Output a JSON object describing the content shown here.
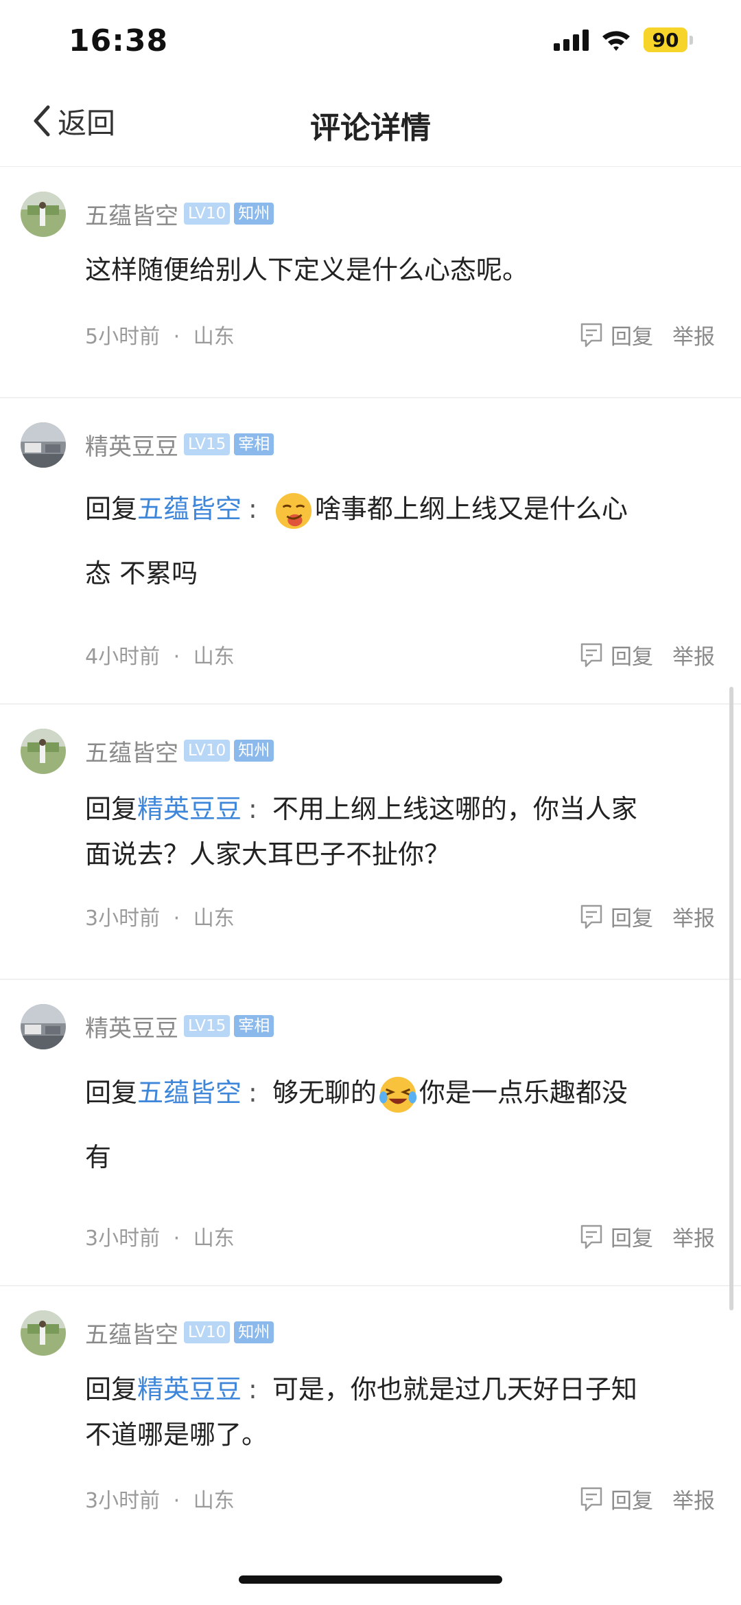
{
  "status": {
    "time": "16:38",
    "battery": "90"
  },
  "nav": {
    "back_label": "返回",
    "title": "评论详情"
  },
  "actions": {
    "reply_label": "回复",
    "report_label": "举报"
  },
  "comments": [
    {
      "user": "五蕴皆空",
      "level": "LV10",
      "title": "知州",
      "reply_prefix": "",
      "reply_target": "",
      "text": "这样随便给别人下定义是什么心态呢。",
      "time": "5小时前",
      "location": "山东"
    },
    {
      "user": "精英豆豆",
      "level": "LV15",
      "title": "宰相",
      "reply_prefix": "回复",
      "reply_target": "五蕴皆空",
      "text": "啥事都上纲上线又是什么心",
      "text_line2": "态  不累吗",
      "time": "4小时前",
      "location": "山东"
    },
    {
      "user": "五蕴皆空",
      "level": "LV10",
      "title": "知州",
      "reply_prefix": "回复",
      "reply_target": "精英豆豆",
      "text": "不用上纲上线这哪的，你当人家",
      "text_line2": "面说去？人家大耳巴子不扯你？",
      "time": "3小时前",
      "location": "山东"
    },
    {
      "user": "精英豆豆",
      "level": "LV15",
      "title": "宰相",
      "reply_prefix": "回复",
      "reply_target": "五蕴皆空",
      "text": "够无聊的",
      "text_after": "你是一点乐趣都没",
      "text_line2": "有",
      "time": "3小时前",
      "location": "山东"
    },
    {
      "user": "五蕴皆空",
      "level": "LV10",
      "title": "知州",
      "reply_prefix": "回复",
      "reply_target": "精英豆豆",
      "text": "可是，你也就是过几天好日子知",
      "text_line2": "不道哪是哪了。",
      "time": "3小时前",
      "location": "山东"
    }
  ],
  "meta_separator": "·",
  "colors": {
    "link": "#3e86d9",
    "badge_level": "#b8d6f5",
    "badge_title": "#8bb9ec",
    "battery": "#f7d42a"
  },
  "icons": {
    "back": "chevron-left-icon",
    "reply": "comment-bubble-icon",
    "signal": "cellular-signal-icon",
    "wifi": "wifi-icon",
    "battery": "battery-icon",
    "emoji_1": "smirking-face-emoji",
    "emoji_2": "laughing-crying-face-emoji"
  }
}
